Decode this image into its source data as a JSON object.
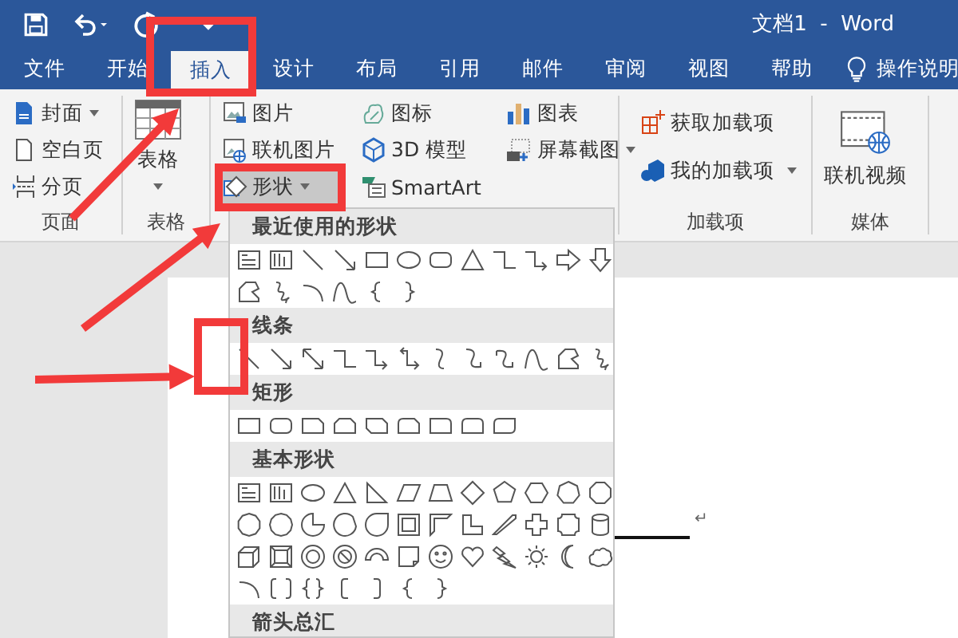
{
  "window": {
    "title": "文档1  -  Word"
  },
  "tabs": [
    {
      "label": "文件",
      "selected": false
    },
    {
      "label": "开始",
      "selected": false
    },
    {
      "label": "插入",
      "selected": true
    },
    {
      "label": "设计",
      "selected": false
    },
    {
      "label": "布局",
      "selected": false
    },
    {
      "label": "引用",
      "selected": false
    },
    {
      "label": "邮件",
      "selected": false
    },
    {
      "label": "审阅",
      "selected": false
    },
    {
      "label": "视图",
      "selected": false
    },
    {
      "label": "帮助",
      "selected": false
    }
  ],
  "tell_me": {
    "label": "操作说明"
  },
  "ribbon": {
    "pages": {
      "label": "页面",
      "items": [
        {
          "label": "封面",
          "dropdown": true
        },
        {
          "label": "空白页",
          "dropdown": false
        },
        {
          "label": "分页",
          "dropdown": false
        }
      ]
    },
    "table": {
      "button": "表格",
      "dropdown": true,
      "label": "表格"
    },
    "illustrations": {
      "columns": [
        {
          "items": [
            {
              "label": "图片",
              "dropdown": false,
              "selected": false
            },
            {
              "label": "联机图片",
              "dropdown": false,
              "selected": false
            },
            {
              "label": "形状",
              "dropdown": true,
              "selected": true
            }
          ]
        },
        {
          "items": [
            {
              "label": "图标",
              "dropdown": false,
              "selected": false
            },
            {
              "label": "3D 模型",
              "dropdown": false,
              "selected": false
            },
            {
              "label": "SmartArt",
              "dropdown": false,
              "selected": false
            }
          ]
        },
        {
          "items": [
            {
              "label": "图表",
              "dropdown": false,
              "selected": false
            },
            {
              "label": "屏幕截图",
              "dropdown": true,
              "selected": false
            }
          ]
        }
      ]
    },
    "addins": {
      "label": "加载项",
      "items": [
        {
          "label": "获取加载项",
          "dropdown": false
        },
        {
          "label": "我的加载项",
          "dropdown": true
        }
      ]
    },
    "media": {
      "button": "联机视频",
      "label": "媒体"
    }
  },
  "shapes_menu": {
    "sections": [
      {
        "heading": "最近使用的形状",
        "kind": "recent"
      },
      {
        "heading": "线条",
        "kind": "lines"
      },
      {
        "heading": "矩形",
        "kind": "rectangles"
      },
      {
        "heading": "基本形状",
        "kind": "basic"
      },
      {
        "heading": "箭头总汇",
        "kind": "arrows"
      }
    ]
  },
  "document": {
    "paragraph_mark": "↵"
  }
}
